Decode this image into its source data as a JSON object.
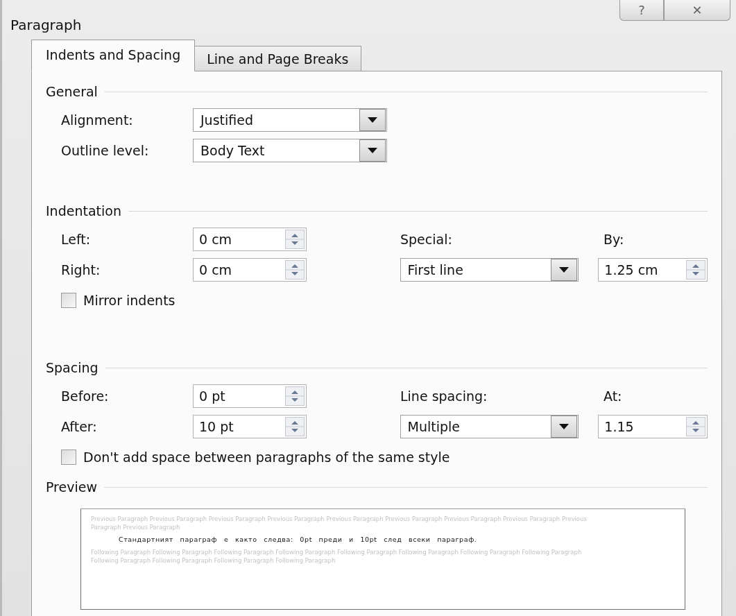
{
  "window": {
    "title": "Paragraph",
    "buttons": [
      {
        "kind": "help",
        "label": "?"
      },
      {
        "kind": "close",
        "label": "✕"
      }
    ]
  },
  "tabs": [
    {
      "label": "Indents and Spacing",
      "selected": true
    },
    {
      "label": "Line and Page Breaks",
      "selected": false
    }
  ],
  "general": {
    "title": "General",
    "rows": [
      {
        "label": "Alignment:",
        "value": "Justified"
      },
      {
        "label": "Outline level:",
        "value": "Body Text"
      }
    ]
  },
  "indentation": {
    "title": "Indentation",
    "left": {
      "label": "Left:",
      "value": "0 cm"
    },
    "right": {
      "label": "Right:",
      "value": "0 cm"
    },
    "special": {
      "label": "Special:",
      "value": "First line"
    },
    "by": {
      "label": "By:",
      "value": "1.25 cm"
    },
    "mirror": {
      "label": "Mirror indents",
      "checked": false
    }
  },
  "spacing": {
    "title": "Spacing",
    "before": {
      "label": "Before:",
      "value": "0 pt"
    },
    "after": {
      "label": "After:",
      "value": "10 pt"
    },
    "line_spacing": {
      "label": "Line spacing:",
      "value": "Multiple"
    },
    "at": {
      "label": "At:",
      "value": "1.15"
    },
    "dont_add": {
      "label": "Don't add space between paragraphs of the same style",
      "checked": false
    }
  },
  "preview": {
    "title": "Preview",
    "previous": "Previous Paragraph Previous Paragraph Previous Paragraph Previous Paragraph Previous Paragraph Previous Paragraph Previous Paragraph Previous Paragraph Previous Paragraph Previous Paragraph",
    "sample": "Стандартният параграф е както следва: 0pt преди и 10pt след всеки параграф.",
    "following": "Following Paragraph Following Paragraph Following Paragraph Following Paragraph Following Paragraph Following Paragraph Following Paragraph Following Paragraph Following Paragraph Following Paragraph Following Paragraph Following Paragraph"
  }
}
